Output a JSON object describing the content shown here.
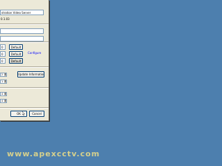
{
  "dialog": {
    "server_name": "stration Video Server",
    "version": "0.1.03",
    "field_a": "",
    "field_b": "",
    "rows": [
      {
        "value": "0",
        "button": "Default"
      },
      {
        "value": "0",
        "button": "Default"
      },
      {
        "value": "0",
        "button": "Default"
      }
    ],
    "configure_label": "Configure",
    "spinners_top": [
      "2",
      "1"
    ],
    "update_button": "Update Information",
    "spinners_bottom": [
      "4",
      "4"
    ],
    "ok_button": "OK",
    "cancel_button": "Cancel"
  },
  "watermark": "www.apexcctv.com",
  "colors": {
    "desktop": "#4d7fae",
    "dialog": "#ece9d8",
    "watermark": "#d6d08c"
  }
}
